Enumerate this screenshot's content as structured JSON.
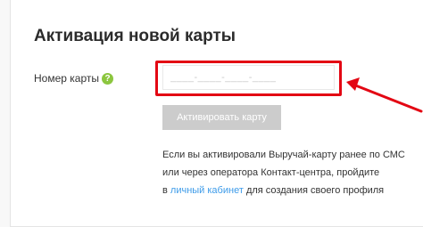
{
  "form": {
    "title": "Активация новой карты",
    "card_number_label": "Номер карты",
    "help_symbol": "?",
    "card_number_placeholder": "____-____-____-____",
    "card_number_value": "",
    "activate_button_label": "Активировать карту"
  },
  "info": {
    "line1": "Если вы активировали Выручай-карту ранее по СМС",
    "line2": "или через оператора Контакт-центра, пройдите",
    "line3_prefix": "в",
    "link_text": "личный кабинет",
    "line3_suffix": "для создания своего профиля"
  },
  "colors": {
    "highlight": "#e30613",
    "help_icon": "#8cc63f",
    "link": "#3d9be9",
    "button_disabled": "#cccccc"
  },
  "icons": {
    "help": "help-icon",
    "annotation": "arrow-left-icon"
  }
}
